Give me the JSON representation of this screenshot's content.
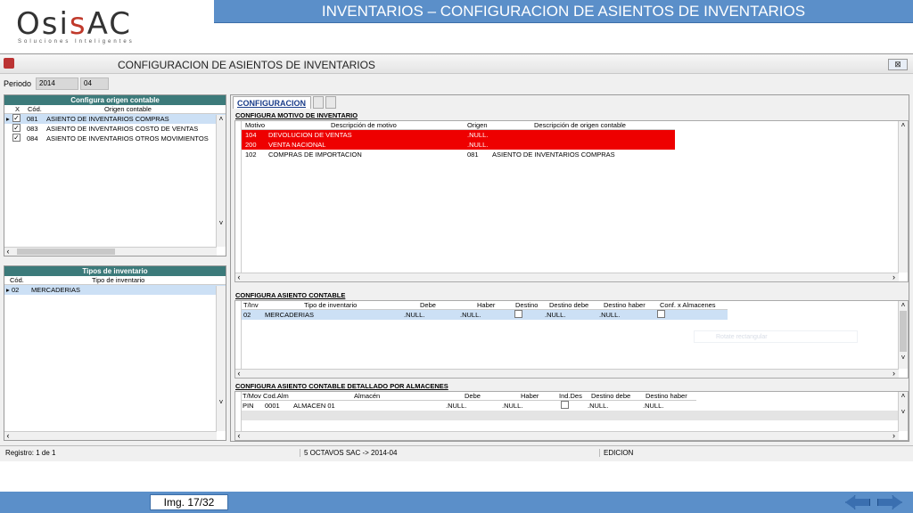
{
  "header": {
    "title": "INVENTARIOS – CONFIGURACION DE ASIENTOS DE INVENTARIOS"
  },
  "logo": {
    "brand_a": "Osi",
    "brand_b": "s",
    "brand_c": "AC",
    "tagline": "Soluciones Inteligentes"
  },
  "window": {
    "title": "CONFIGURACION DE ASIENTOS DE INVENTARIOS",
    "close": "⊠"
  },
  "periodo": {
    "label": "Periodo",
    "year": "2014",
    "month": "04"
  },
  "origen": {
    "title": "Configura origen contable",
    "cols": {
      "x": "X",
      "cod": "Cód.",
      "desc": "Origen contable"
    },
    "rows": [
      {
        "cod": "081",
        "desc": "ASIENTO DE INVENTARIOS COMPRAS"
      },
      {
        "cod": "083",
        "desc": "ASIENTO DE INVENTARIOS COSTO DE VENTAS"
      },
      {
        "cod": "084",
        "desc": "ASIENTO DE INVENTARIOS OTROS MOVIMIENTOS"
      }
    ]
  },
  "tipos": {
    "title": "Tipos de inventario",
    "cols": {
      "cod": "Cód.",
      "desc": "Tipo de inventario"
    },
    "rows": [
      {
        "cod": "02",
        "desc": "MERCADERIAS"
      }
    ]
  },
  "config": {
    "tab": "CONFIGURACION",
    "motivo": {
      "title": "CONFIGURA MOTIVO DE INVENTARIO",
      "cols": {
        "motivo": "Motivo",
        "desc": "Descripción de motivo",
        "origen": "Origen",
        "desc_origen": "Descripción de origen contable"
      },
      "rows": [
        {
          "motivo": "104",
          "desc": "DEVOLUCION DE VENTAS",
          "origen": ".NULL.",
          "desc_origen": ""
        },
        {
          "motivo": "200",
          "desc": "VENTA NACIONAL",
          "origen": ".NULL.",
          "desc_origen": ""
        },
        {
          "motivo": "102",
          "desc": "COMPRAS DE IMPORTACION",
          "origen": "081",
          "desc_origen": "ASIENTO DE INVENTARIOS COMPRAS"
        }
      ]
    },
    "asiento": {
      "title": "CONFIGURA ASIENTO CONTABLE",
      "cols": {
        "tinv": "T/Inv",
        "tipo": "Tipo de inventario",
        "debe": "Debe",
        "haber": "Haber",
        "destino": "Destino",
        "destino_debe": "Destino debe",
        "destino_haber": "Destino haber",
        "conf": "Conf. x Almacenes"
      },
      "rows": [
        {
          "tinv": "02",
          "tipo": "MERCADERIAS",
          "debe": ".NULL.",
          "haber": ".NULL.",
          "destino_debe": ".NULL.",
          "destino_haber": ".NULL."
        }
      ],
      "ghost": "Rotate rectangular"
    },
    "almacen": {
      "title": "CONFIGURA ASIENTO CONTABLE DETALLADO POR ALMACENES",
      "cols": {
        "tmov": "T/Mov",
        "cod": "Cod.Alm",
        "alm": "Almacén",
        "debe": "Debe",
        "haber": "Haber",
        "ind": "Ind.Des",
        "destino_debe": "Destino debe",
        "destino_haber": "Destino haber"
      },
      "rows": [
        {
          "tmov": "PIN",
          "cod": "0001",
          "alm": "ALMACEN 01",
          "debe": ".NULL.",
          "haber": ".NULL.",
          "destino_debe": ".NULL.",
          "destino_haber": ".NULL."
        }
      ]
    }
  },
  "status": {
    "registro": "Registro: 1 de 1",
    "empresa": "5 OCTAVOS SAC -> 2014-04",
    "modo": "EDICION"
  },
  "footer": {
    "img": "Img. 17/32"
  },
  "colors": {
    "accent": "#5b8fc9",
    "panel_header": "#3c7a7a",
    "highlight": "#e00000"
  }
}
